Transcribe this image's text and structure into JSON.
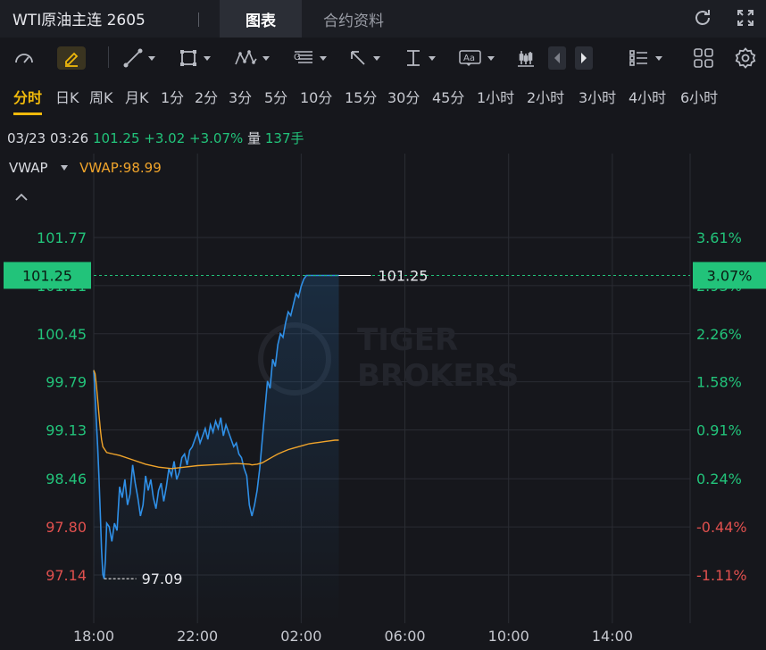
{
  "header": {
    "title": "WTI原油主连 2605",
    "tabs": [
      {
        "label": "图表",
        "active": true
      },
      {
        "label": "合约资料",
        "active": false
      }
    ],
    "actions": [
      "refresh-icon",
      "fullscreen-icon"
    ]
  },
  "toolbar": {
    "tools": [
      "indicator-gauge-icon",
      "pencil-icon",
      "line-tool-icon",
      "rectangle-tool-icon",
      "pattern-tool-icon",
      "fib-tool-icon",
      "arrow-tool-icon",
      "measure-tool-icon",
      "text-tool-icon",
      "candle-tool-icon",
      "prev-icon",
      "next-icon",
      "list-icon",
      "grid-icon",
      "settings-icon"
    ]
  },
  "periods": {
    "items": [
      "分时",
      "日K",
      "周K",
      "月K",
      "1分",
      "2分",
      "3分",
      "5分",
      "10分",
      "15分",
      "30分",
      "45分",
      "1小时",
      "2小时",
      "3小时",
      "4小时",
      "6小时"
    ],
    "active": "分时"
  },
  "quote": {
    "datetime": "03/23 03:26",
    "price": "101.25",
    "change": "+3.02",
    "change_pct": "+3.07%",
    "volume_label": "量",
    "volume": "137手"
  },
  "indicator": {
    "name": "VWAP",
    "value_label": "VWAP:98.99"
  },
  "colors": {
    "up": "#22c37a",
    "down": "#e0504e",
    "price_line": "#2f8fe6",
    "vwap_line": "#f0a42b",
    "accent": "#f0b90b"
  },
  "watermark": [
    "TIGER",
    "BROKERS"
  ],
  "chart_data": {
    "type": "line",
    "x_tick_labels": [
      "18:00",
      "22:00",
      "02:00",
      "06:00",
      "10:00",
      "14:00"
    ],
    "y_tick_labels": [
      "101.77",
      "101.11",
      "100.45",
      "99.79",
      "99.13",
      "98.46",
      "97.80",
      "97.14"
    ],
    "y_right_tick_labels": [
      "3.61%",
      "2.93%",
      "2.26%",
      "1.58%",
      "0.91%",
      "0.24%",
      "-0.44%",
      "-1.11%"
    ],
    "ylim": [
      96.5,
      102.4
    ],
    "prev_close": 98.23,
    "last_price_label": "101.25",
    "last_pct_label": "3.07%",
    "min_label": "97.09",
    "series": [
      {
        "name": "price",
        "x": [
          0.0,
          0.05,
          0.1,
          0.15,
          0.2,
          0.25,
          0.3,
          0.35,
          0.4,
          0.45,
          0.5,
          0.6,
          0.7,
          0.8,
          0.9,
          1.0,
          1.1,
          1.2,
          1.3,
          1.4,
          1.5,
          1.6,
          1.7,
          1.8,
          1.9,
          2.0,
          2.1,
          2.2,
          2.3,
          2.4,
          2.5,
          2.6,
          2.7,
          2.8,
          2.9,
          3.0,
          3.1,
          3.2,
          3.3,
          3.4,
          3.5,
          3.6,
          3.7,
          3.8,
          3.9,
          4.0,
          4.1,
          4.2,
          4.3,
          4.4,
          4.5,
          4.6,
          4.7,
          4.8,
          4.9,
          5.0,
          5.1,
          5.2,
          5.3,
          5.4,
          5.5,
          5.6,
          5.7,
          5.8,
          5.9,
          6.0,
          6.1,
          6.2,
          6.3,
          6.4,
          6.5,
          6.6,
          6.7,
          6.8,
          6.9,
          7.0,
          7.1,
          7.2,
          7.3,
          7.4,
          7.5,
          7.6,
          7.7,
          7.8,
          7.9,
          8.0,
          8.1,
          8.2,
          8.3,
          8.4,
          8.5,
          8.6,
          8.7,
          8.8,
          8.9,
          9.0,
          9.1,
          9.2,
          9.3,
          9.4,
          9.45
        ],
        "values": [
          99.95,
          99.6,
          99.25,
          98.9,
          98.5,
          98.0,
          97.5,
          97.15,
          97.09,
          97.35,
          97.85,
          97.8,
          97.6,
          97.85,
          97.75,
          98.35,
          98.2,
          98.45,
          98.1,
          98.25,
          98.65,
          98.4,
          98.2,
          97.95,
          98.1,
          98.5,
          98.3,
          98.45,
          98.2,
          98.05,
          98.3,
          98.4,
          98.15,
          98.35,
          98.6,
          98.5,
          98.7,
          98.45,
          98.55,
          98.75,
          98.8,
          98.65,
          98.85,
          98.9,
          99.0,
          99.1,
          98.95,
          99.05,
          99.15,
          99.0,
          99.2,
          99.1,
          99.25,
          99.15,
          99.3,
          99.05,
          99.2,
          99.1,
          99.0,
          98.9,
          98.95,
          98.8,
          98.75,
          98.6,
          98.5,
          98.1,
          97.95,
          98.1,
          98.3,
          98.6,
          99.0,
          99.4,
          99.8,
          99.7,
          100.1,
          100.0,
          100.3,
          100.45,
          100.4,
          100.6,
          100.75,
          100.7,
          100.85,
          101.0,
          100.95,
          101.1,
          101.2,
          101.25,
          101.25,
          101.25,
          101.25,
          101.25,
          101.25,
          101.25,
          101.25,
          101.25,
          101.25,
          101.25,
          101.25,
          101.25,
          101.25
        ]
      },
      {
        "name": "VWAP",
        "x": [
          0.0,
          0.05,
          0.1,
          0.15,
          0.2,
          0.25,
          0.3,
          0.35,
          0.5,
          0.75,
          1.0,
          1.5,
          2.0,
          2.5,
          3.0,
          3.5,
          4.0,
          4.5,
          5.0,
          5.5,
          6.0,
          6.1,
          6.3,
          6.5,
          6.7,
          6.9,
          7.1,
          7.3,
          7.5,
          7.7,
          7.9,
          8.1,
          8.3,
          8.5,
          8.7,
          8.9,
          9.1,
          9.3,
          9.45
        ],
        "values": [
          99.95,
          99.9,
          99.75,
          99.55,
          99.35,
          99.15,
          99.0,
          98.9,
          98.82,
          98.8,
          98.78,
          98.72,
          98.66,
          98.62,
          98.6,
          98.62,
          98.64,
          98.65,
          98.66,
          98.67,
          98.66,
          98.65,
          98.66,
          98.68,
          98.72,
          98.76,
          98.8,
          98.83,
          98.86,
          98.88,
          98.9,
          98.92,
          98.94,
          98.95,
          98.96,
          98.97,
          98.98,
          98.99,
          98.99
        ]
      }
    ],
    "last_x": 9.45,
    "x_range_hours": [
      0,
      23
    ]
  }
}
